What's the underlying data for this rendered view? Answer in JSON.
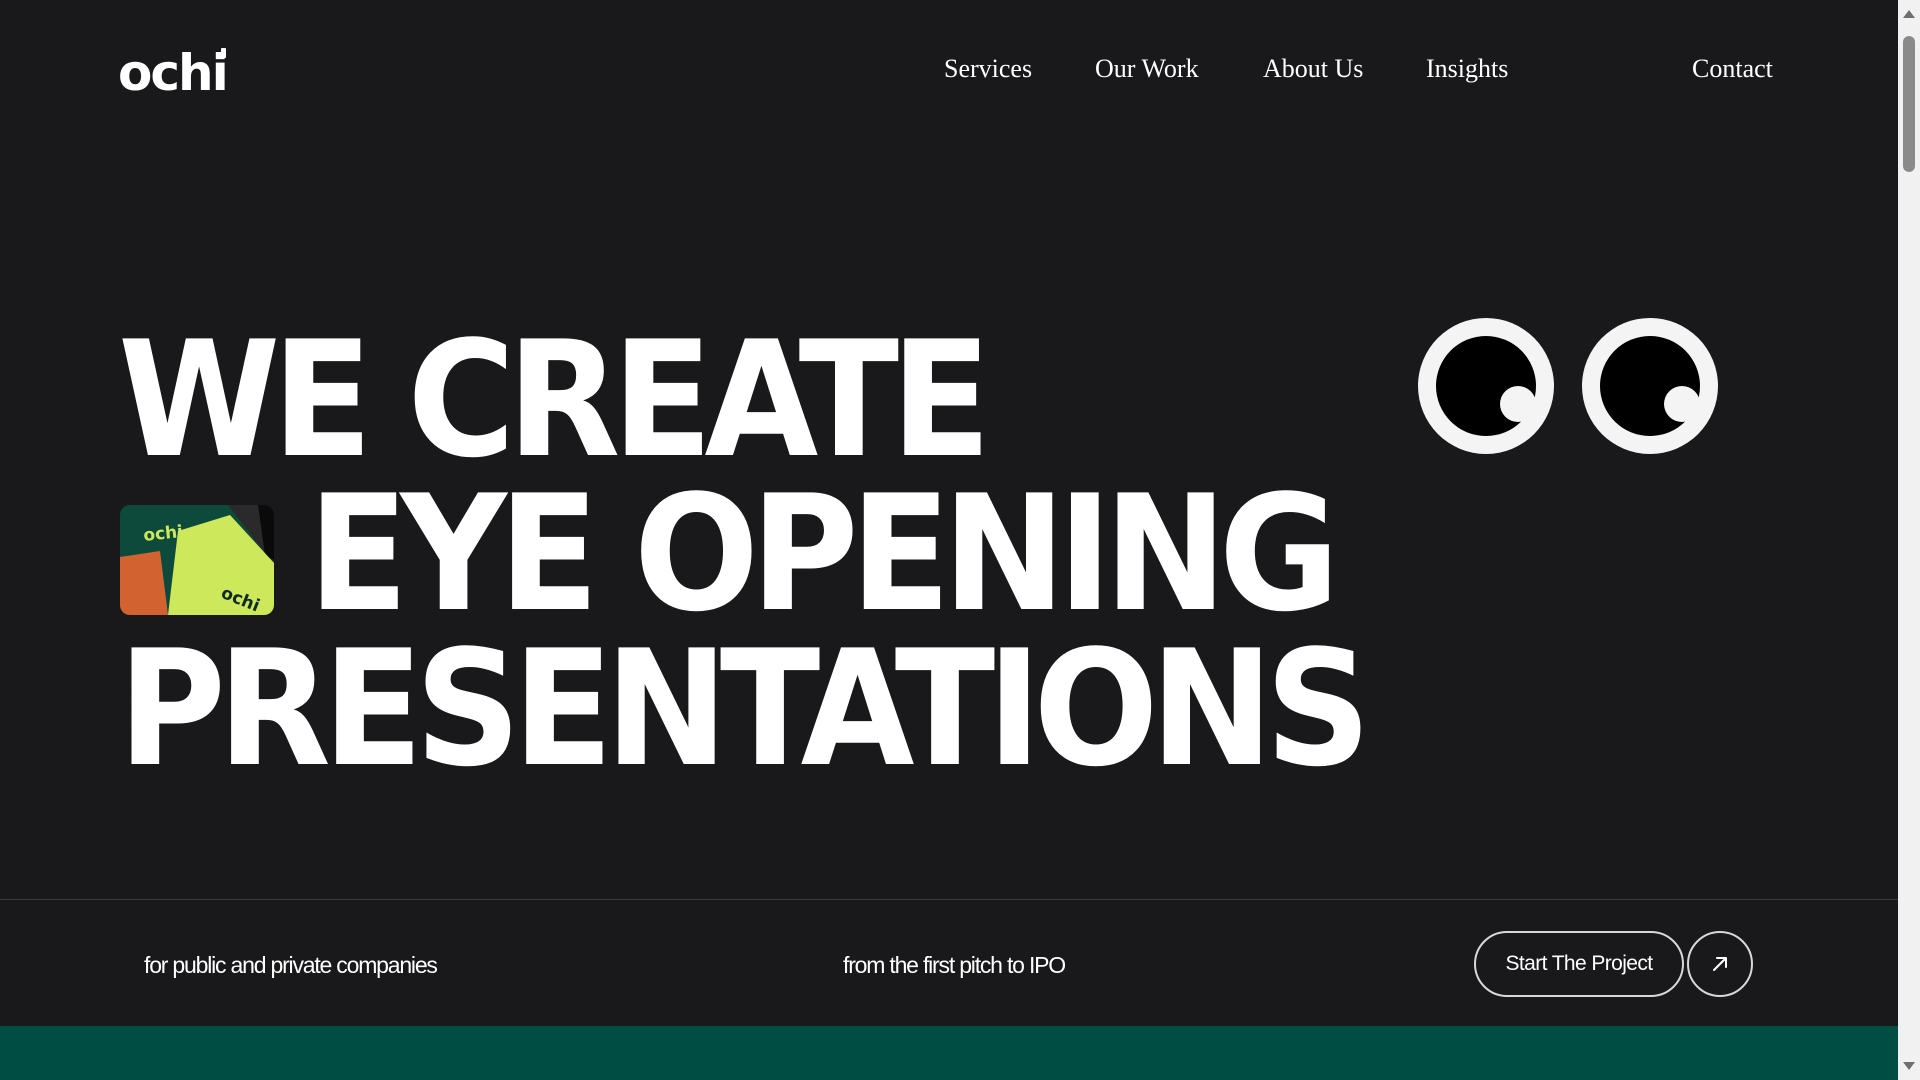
{
  "brand": {
    "logo_text": "ochi",
    "icon": "ochi-wordmark"
  },
  "nav": {
    "items": [
      {
        "label": "Services"
      },
      {
        "label": "Our Work"
      },
      {
        "label": "About Us"
      },
      {
        "label": "Insights"
      }
    ],
    "contact_label": "Contact"
  },
  "hero": {
    "line1": "WE CREATE",
    "line2": "EYE OPENING",
    "line3": "PRESENTATIONS",
    "thumbnail": {
      "icon": "ochi-brand-card-image",
      "card_text": "ochi"
    },
    "eyes": {
      "icon": "googly-eyes"
    }
  },
  "footer_bar": {
    "tagline_left": "for public and private companies",
    "tagline_mid": "from the first pitch to IPO",
    "cta_label": "Start The Project",
    "cta_icon": "arrow-up-right-icon"
  },
  "colors": {
    "background": "#19191b",
    "text": "#ffffff",
    "accent_green": "#004d43",
    "card_lime": "#cde85a",
    "card_orange": "#d2622f",
    "card_green": "#0e4a3c"
  }
}
